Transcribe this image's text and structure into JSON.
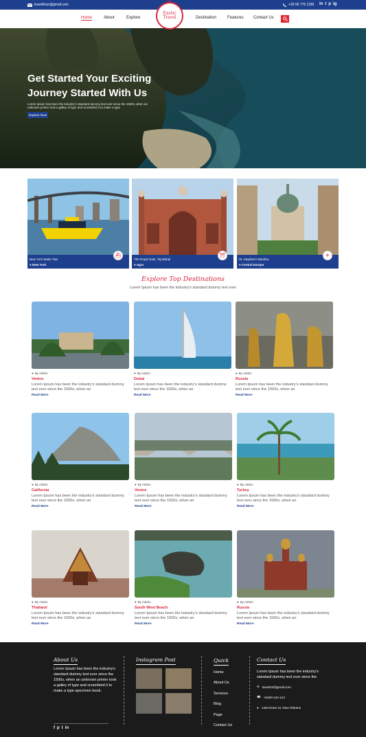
{
  "topbar": {
    "email": "travelltour@gmail.com",
    "phone": "+39 06 776 1189",
    "social": [
      "in",
      "t",
      "p",
      "ig"
    ]
  },
  "nav": {
    "items": [
      "Home",
      "About",
      "Explore",
      "Destination",
      "Features",
      "Contact Us"
    ],
    "logo_line1": "Exotic",
    "logo_line2": "Travel"
  },
  "hero": {
    "title": "Get Started Your Exciting Journey Started With Us",
    "text": "Lorem Ipsum has been the industry's standard dummy text ever since the 1500s, when an unknown printer took a galley of type and scrambled it to make a type",
    "button": "Explore Now"
  },
  "featured": [
    {
      "title": "New York Water Taxi",
      "location": "New York",
      "badge_icon": "ship-icon"
    },
    {
      "title": "The Royal Gate, Taj Mahal",
      "location": "Agra",
      "badge_icon": "gate-icon"
    },
    {
      "title": "St. Stephen's Basilica",
      "location": "Central Europe",
      "badge_icon": "plane-icon"
    }
  ],
  "explore": {
    "title": "Explore Top Destinations",
    "subtitle": "Lorem Ipsum has been the industry's standard dummy text ever",
    "by": "By Admin",
    "desc": "Lorem Ipsum has been the industry's standard dummy text ever since the 1500s, when an",
    "more": "Read More",
    "places": [
      "Venice",
      "Dubai",
      "Russia",
      "California",
      "Venice",
      "Turkey",
      "Thailand",
      "South West Beach",
      "Russia"
    ]
  },
  "footer": {
    "about_title": "About Us",
    "about_text": "Lorem Ipsum has been the industry's standard dummy text ever since the 1500s, when an unknown printer took a galley of type and scrambled it to make a type specimen book.",
    "insta_title": "Instagram Post",
    "quick_title": "Quick",
    "quick_links": [
      "Home",
      "About Us",
      "Services",
      "Blog",
      "Page",
      "Contact Us"
    ],
    "contact_title": "Contact Us",
    "contact_text": "Lorem Ipsum has been the industry's standard dummy text ever since the",
    "contact_email": "tarvel22@gmail.com",
    "contact_phone": "+8100-124-124",
    "contact_address": "1404 Erato St, New Orleans"
  },
  "colors": {
    "brand_blue": "#1e3f8e",
    "accent_red": "#d7263d",
    "footer_bg": "#1b1b1b"
  }
}
